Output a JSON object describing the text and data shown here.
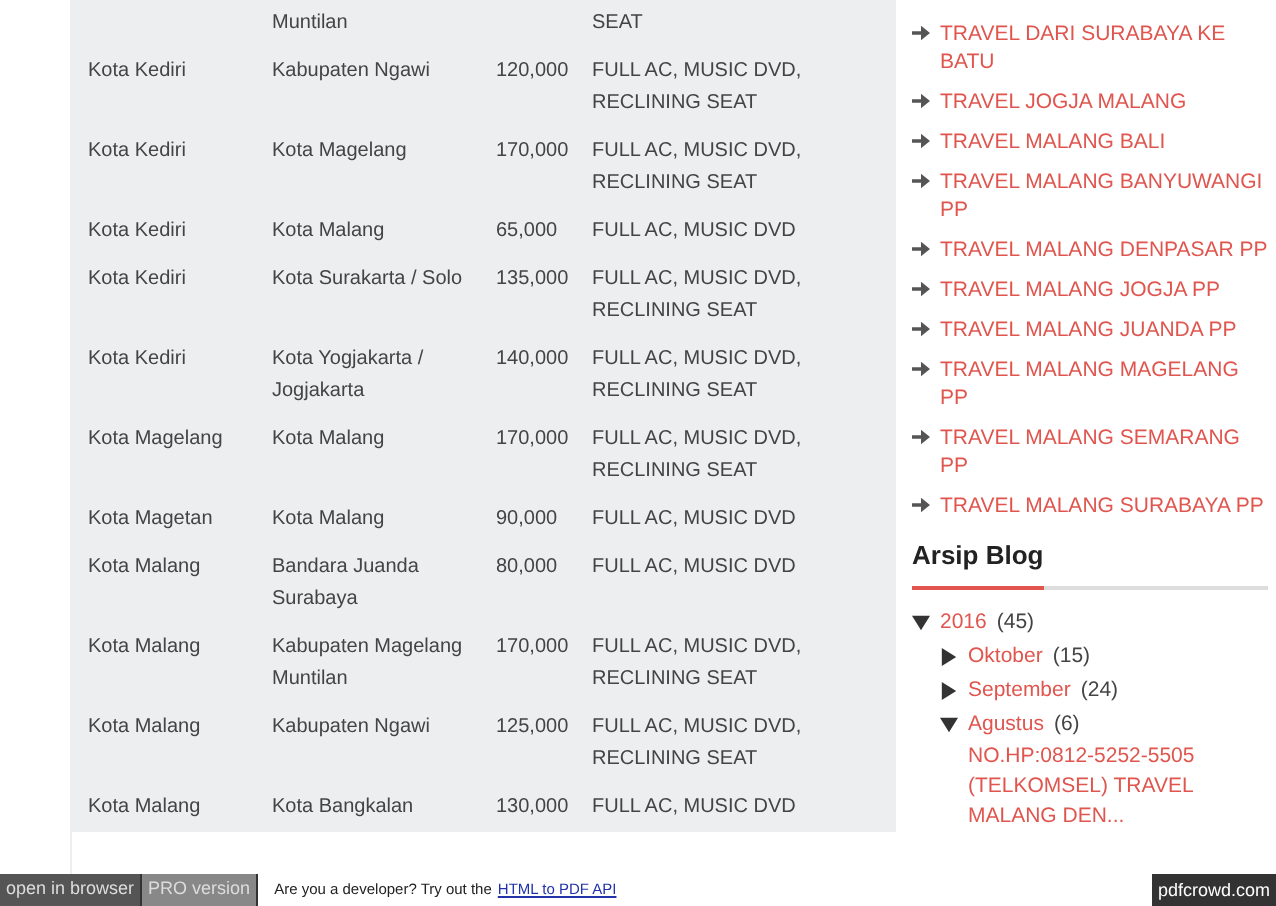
{
  "table": {
    "rows": [
      {
        "cells": [
          "",
          "Muntilan",
          "",
          "SEAT"
        ]
      },
      {
        "cells": [
          "Kota Kediri",
          "Kabupaten Ngawi",
          "120,000",
          "FULL AC, MUSIC DVD, RECLINING SEAT"
        ]
      },
      {
        "cells": [
          "Kota Kediri",
          "Kota Magelang",
          "170,000",
          "FULL AC, MUSIC DVD, RECLINING SEAT"
        ]
      },
      {
        "cells": [
          "Kota Kediri",
          "Kota Malang",
          "65,000",
          "FULL AC, MUSIC DVD"
        ]
      },
      {
        "cells": [
          "Kota Kediri",
          "Kota Surakarta / Solo",
          "135,000",
          "FULL AC, MUSIC DVD, RECLINING SEAT"
        ]
      },
      {
        "cells": [
          "Kota Kediri",
          "Kota Yogjakarta / Jogjakarta",
          "140,000",
          "FULL AC, MUSIC DVD, RECLINING SEAT"
        ]
      },
      {
        "cells": [
          "Kota Magelang",
          "Kota Malang",
          "170,000",
          "FULL AC, MUSIC DVD, RECLINING SEAT"
        ]
      },
      {
        "cells": [
          "Kota Magetan",
          "Kota Malang",
          "90,000",
          "FULL AC, MUSIC DVD"
        ]
      },
      {
        "cells": [
          "Kota Malang",
          "Bandara Juanda Surabaya",
          "80,000",
          "FULL AC, MUSIC DVD"
        ]
      },
      {
        "cells": [
          "Kota Malang",
          "Kabupaten Magelang Muntilan",
          "170,000",
          "FULL AC, MUSIC DVD, RECLINING SEAT"
        ]
      },
      {
        "cells": [
          "Kota Malang",
          "Kabupaten Ngawi",
          "125,000",
          "FULL AC, MUSIC DVD, RECLINING SEAT"
        ]
      },
      {
        "cells": [
          "Kota Malang",
          "Kota Bangkalan",
          "130,000",
          "FULL AC, MUSIC DVD"
        ]
      }
    ]
  },
  "sidebar": {
    "links": [
      "TRAVEL DARI SURABAYA KE BATU",
      "TRAVEL JOGJA MALANG",
      "TRAVEL MALANG BALI",
      "TRAVEL MALANG BANYUWANGI PP",
      "TRAVEL MALANG DENPASAR PP",
      "TRAVEL MALANG JOGJA PP",
      "TRAVEL MALANG JUANDA PP",
      "TRAVEL MALANG MAGELANG PP",
      "TRAVEL MALANG SEMARANG PP",
      "TRAVEL MALANG SURABAYA PP"
    ],
    "archive": {
      "title": "Arsip Blog",
      "tree": [
        {
          "label": "2016",
          "count": "(45)",
          "expanded": true,
          "children": [
            {
              "label": "Oktober",
              "count": "(15)",
              "expanded": false
            },
            {
              "label": "September",
              "count": "(24)",
              "expanded": false
            },
            {
              "label": "Agustus",
              "count": "(6)",
              "expanded": true,
              "posts": [
                "NO.HP:0812-5252-5505 (TELKOMSEL) TRAVEL MALANG DEN..."
              ]
            }
          ]
        }
      ]
    }
  },
  "footer": {
    "buttons": [
      "open in browser",
      "PRO version"
    ],
    "message": "Are you a developer? Try out the",
    "link": "HTML to PDF API",
    "brand": "pdfcrowd.com"
  }
}
